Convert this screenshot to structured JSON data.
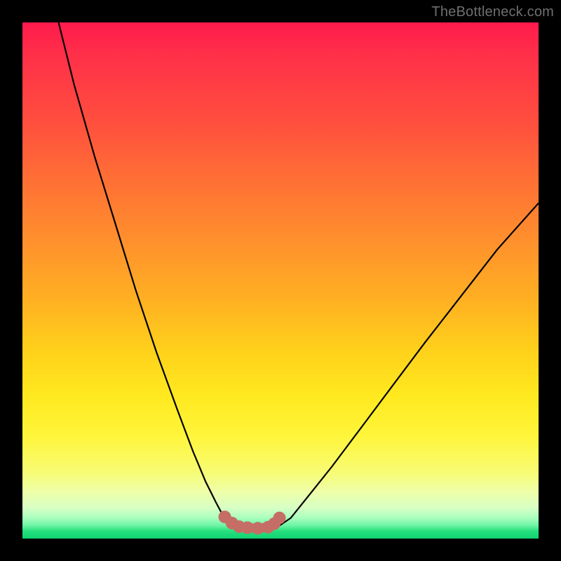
{
  "watermark": "TheBottleneck.com",
  "colors": {
    "frame_bg": "#000000",
    "watermark_text": "#6f6f6f",
    "curve_stroke": "#000000",
    "marker_fill": "#c56e66",
    "marker_stroke": "#c56e66",
    "gradient_stops": [
      "#ff1a4c",
      "#ff2f49",
      "#ff4b3f",
      "#ff6e35",
      "#ff8f2d",
      "#ffb122",
      "#ffd21b",
      "#ffe81f",
      "#fff53a",
      "#f8fb72",
      "#eeffa9",
      "#d8ffc4",
      "#a9ffbe",
      "#6cf4a3",
      "#27e07e",
      "#0fd472"
    ]
  },
  "chart_data": {
    "type": "line",
    "title": "",
    "xlabel": "",
    "ylabel": "",
    "xlim": [
      0,
      100
    ],
    "ylim": [
      0,
      100
    ],
    "grid": false,
    "series": [
      {
        "name": "bottleneck-curve-left",
        "x": [
          7,
          10,
          14,
          18,
          22,
          26,
          30,
          33,
          35.5,
          37.5,
          39,
          40.5,
          42
        ],
        "y": [
          100,
          88,
          74,
          61,
          48,
          36,
          25,
          17,
          11,
          7,
          4.2,
          2.6,
          2.1
        ]
      },
      {
        "name": "bottleneck-curve-bottom",
        "x": [
          42,
          43.5,
          45,
          46.5,
          48,
          49.5
        ],
        "y": [
          2.1,
          2.0,
          2.0,
          2.0,
          2.1,
          2.3
        ]
      },
      {
        "name": "bottleneck-curve-right",
        "x": [
          49.5,
          52,
          56,
          60,
          66,
          72,
          78,
          85,
          92,
          100
        ],
        "y": [
          2.3,
          4,
          9,
          14,
          22,
          30,
          38,
          47,
          56,
          65
        ]
      }
    ],
    "markers": {
      "name": "highlighted-points",
      "x": [
        39.2,
        40.6,
        42.0,
        43.6,
        45.6,
        47.6,
        48.8,
        49.8
      ],
      "y": [
        4.2,
        3.0,
        2.3,
        2.1,
        2.0,
        2.2,
        2.9,
        4.0
      ]
    }
  }
}
